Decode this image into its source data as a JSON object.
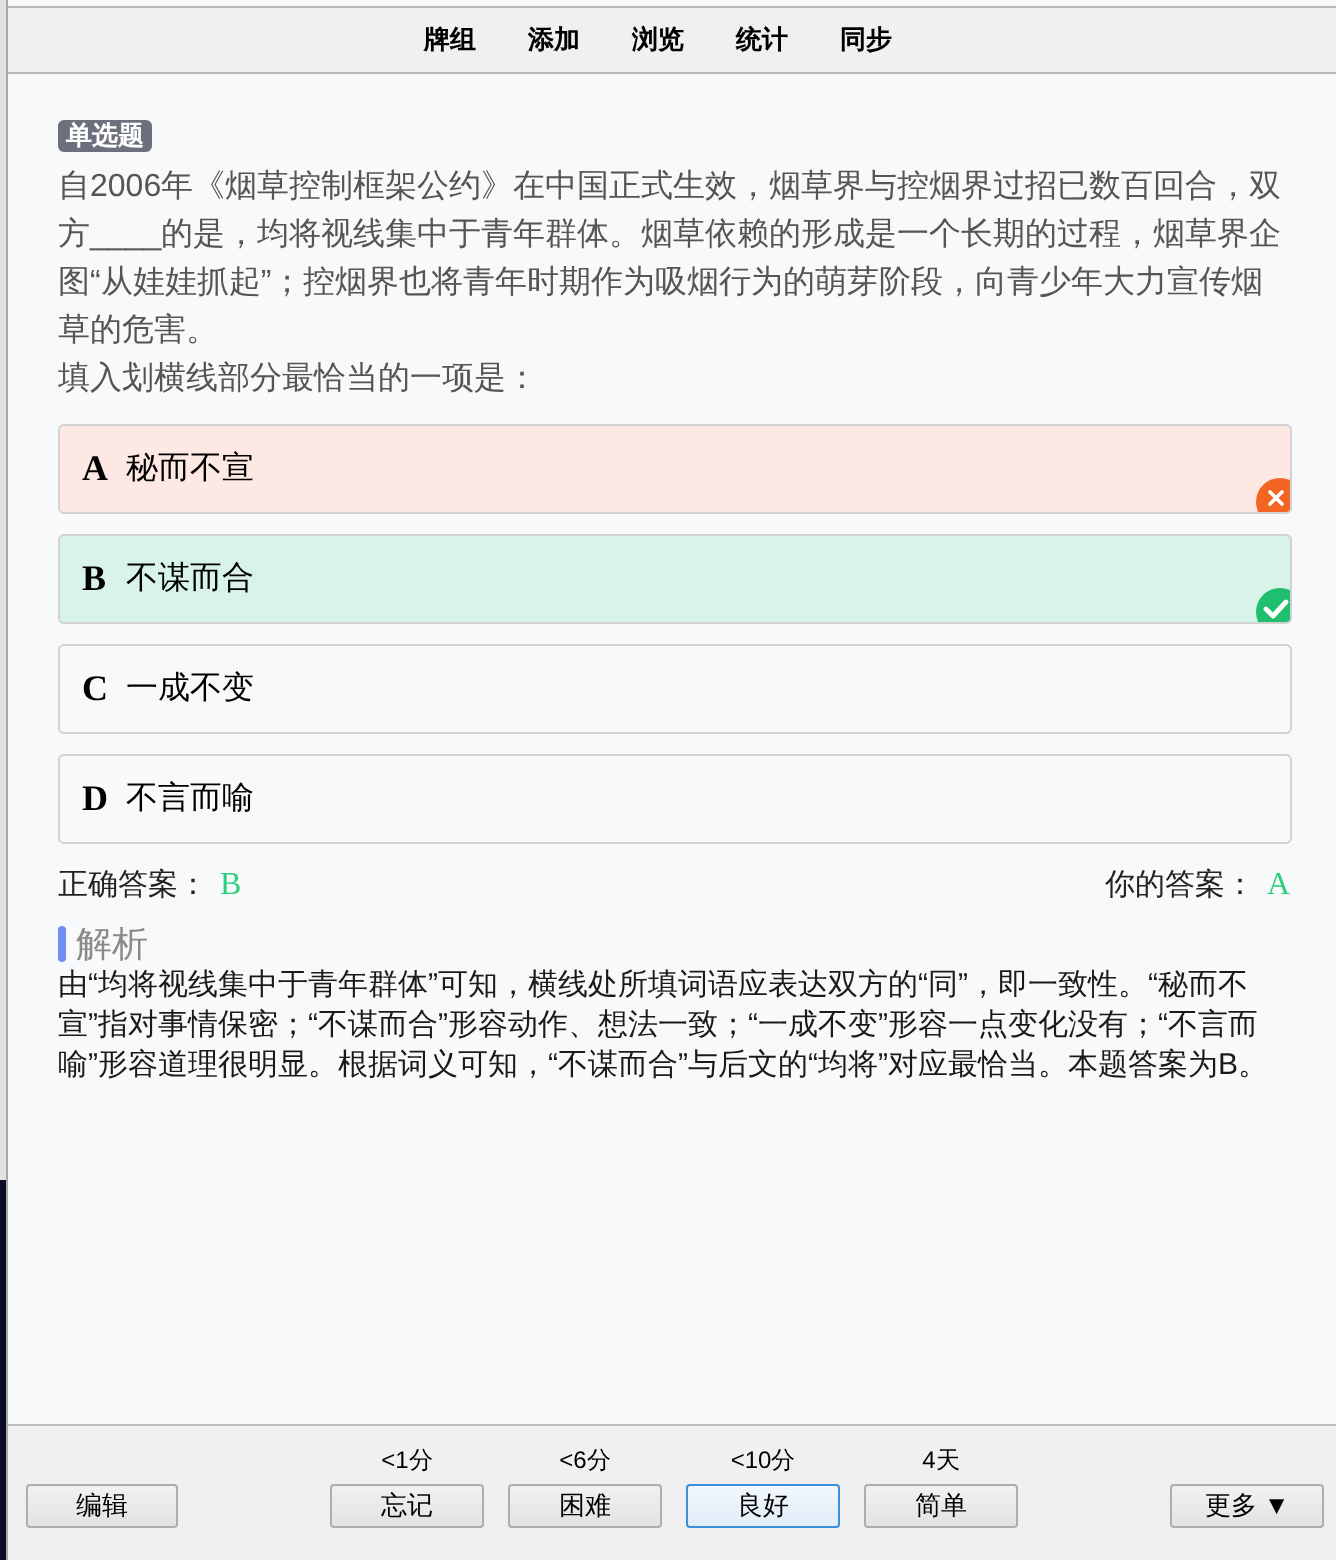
{
  "menu": [
    "牌组",
    "添加",
    "浏览",
    "统计",
    "同步"
  ],
  "question": {
    "type_tag": "单选题",
    "stem": [
      "自2006年《烟草控制框架公约》在中国正式生效，烟草界与控烟界过招已数百回合，双方____的是，均将视线集中于青年群体。烟草依赖的形成是一个长期的过程，烟草界企图“从娃娃抓起”；控烟界也将青年时期作为吸烟行为的萌芽阶段，向青少年大力宣传烟草的危害。",
      "填入划横线部分最恰当的一项是："
    ]
  },
  "options": [
    {
      "letter": "A",
      "text": "秘而不宣",
      "selected": true,
      "correct": false
    },
    {
      "letter": "B",
      "text": "不谋而合",
      "selected": false,
      "correct": true
    },
    {
      "letter": "C",
      "text": "一成不变",
      "selected": false,
      "correct": false
    },
    {
      "letter": "D",
      "text": "不言而喻",
      "selected": false,
      "correct": false
    }
  ],
  "answers": {
    "correct_label": "正确答案：",
    "correct_value": "B",
    "your_label": "你的答案：",
    "your_value": "A"
  },
  "explanation": {
    "heading": "解析",
    "text": "由“均将视线集中于青年群体”可知，横线处所填词语应表达双方的“同”，即一致性。“秘而不宣”指对事情保密；“不谋而合”形容动作、想法一致；“一成不变”形容一点变化没有；“不言而喻”形容道理很明显。根据词义可知，“不谋而合”与后文的“均将”对应最恰当。本题答案为B。"
  },
  "bottom_bar": {
    "edit_button": "编辑",
    "ease_buttons": [
      {
        "interval": "<1分",
        "label": "忘记",
        "selected": false
      },
      {
        "interval": "<6分",
        "label": "困难",
        "selected": false
      },
      {
        "interval": "<10分",
        "label": "良好",
        "selected": true
      },
      {
        "interval": "4天",
        "label": "简单",
        "selected": false
      }
    ],
    "more_button": "更多 ▼"
  }
}
